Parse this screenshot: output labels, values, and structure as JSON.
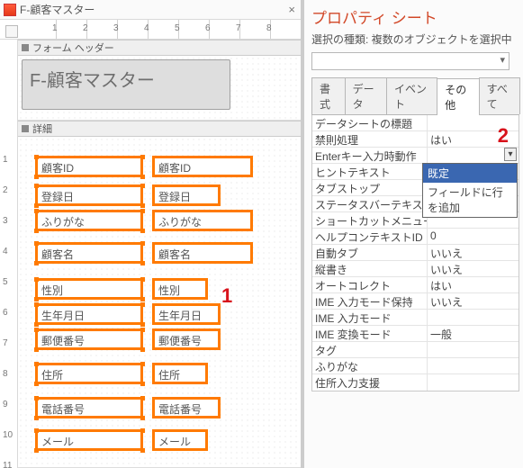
{
  "tab_header": {
    "title": "F-顧客マスター",
    "close": "×"
  },
  "ruler_numbers": [
    "1",
    "2",
    "3",
    "4",
    "5",
    "6",
    "7",
    "8"
  ],
  "vruler_numbers": [
    "1",
    "2",
    "3",
    "4",
    "5",
    "6",
    "7",
    "8",
    "9",
    "10",
    "11"
  ],
  "section_form_header": "フォーム ヘッダー",
  "section_detail": "詳細",
  "form_title": "F-顧客マスター",
  "fields": [
    {
      "label": "顧客ID",
      "ctl": "顧客ID",
      "w": "w-long"
    },
    {
      "label": "登録日",
      "ctl": "登録日",
      "w": "w-mid"
    },
    {
      "label": "ふりがな",
      "ctl": "ふりがな",
      "w": "w-long"
    },
    {
      "label": "顧客名",
      "ctl": "顧客名",
      "w": "w-long"
    },
    {
      "label": "性別",
      "ctl": "性別",
      "w": "w-short"
    },
    {
      "label": "生年月日",
      "ctl": "生年月日",
      "w": "w-mid"
    },
    {
      "label": "郵便番号",
      "ctl": "郵便番号",
      "w": "w-mid"
    },
    {
      "label": "住所",
      "ctl": "住所",
      "w": "w-short"
    },
    {
      "label": "電話番号",
      "ctl": "電話番号",
      "w": "w-mid"
    },
    {
      "label": "メール",
      "ctl": "メール",
      "w": "w-short"
    }
  ],
  "prop_title": "プロパティ シート",
  "sel_text": "選択の種類: 複数のオブジェクトを選択中",
  "tabs": [
    "書式",
    "データ",
    "イベント",
    "その他",
    "すべて"
  ],
  "active_tab": 3,
  "properties": [
    {
      "n": "データシートの標題",
      "v": ""
    },
    {
      "n": "禁則処理",
      "v": "はい"
    },
    {
      "n": "Enterキー入力時動作",
      "v": "",
      "dd": true
    },
    {
      "n": "ヒントテキスト",
      "v": ""
    },
    {
      "n": "タブストップ",
      "v": ""
    },
    {
      "n": "ステータスバーテキスト",
      "v": ""
    },
    {
      "n": "ショートカットメニューバー",
      "v": ""
    },
    {
      "n": "ヘルプコンテキストID",
      "v": "0"
    },
    {
      "n": "自動タブ",
      "v": "いいえ"
    },
    {
      "n": "縦書き",
      "v": "いいえ"
    },
    {
      "n": "オートコレクト",
      "v": "はい"
    },
    {
      "n": "IME 入力モード保持",
      "v": "いいえ"
    },
    {
      "n": "IME 入力モード",
      "v": ""
    },
    {
      "n": "IME 変換モード",
      "v": "一般"
    },
    {
      "n": "タグ",
      "v": ""
    },
    {
      "n": "ふりがな",
      "v": ""
    },
    {
      "n": "住所入力支援",
      "v": ""
    }
  ],
  "dropdown": {
    "items": [
      "既定",
      "フィールドに行を追加"
    ],
    "selected": 0
  },
  "callouts": {
    "one": "1",
    "two": "2"
  }
}
